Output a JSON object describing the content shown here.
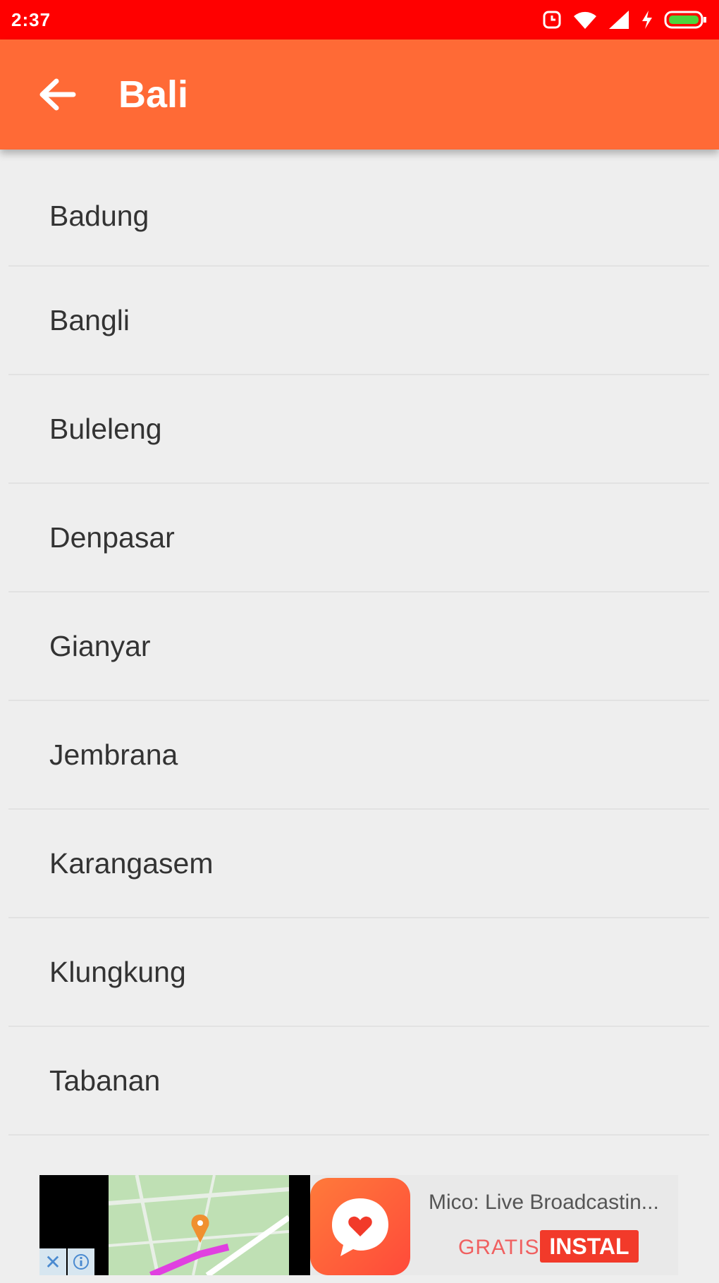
{
  "status_bar": {
    "time": "2:37",
    "icons": [
      "alarm-icon",
      "wifi-icon",
      "signal-icon",
      "charging-icon",
      "battery-icon"
    ],
    "color": "#ff0000"
  },
  "app_bar": {
    "title": "Bali",
    "back_icon": "arrow-left-icon",
    "color": "#ff6a36"
  },
  "list": {
    "items": [
      {
        "label": "Badung"
      },
      {
        "label": "Bangli"
      },
      {
        "label": "Buleleng"
      },
      {
        "label": "Denpasar"
      },
      {
        "label": "Gianyar"
      },
      {
        "label": "Jembrana"
      },
      {
        "label": "Karangasem"
      },
      {
        "label": "Klungkung"
      },
      {
        "label": "Tabanan"
      }
    ]
  },
  "ad": {
    "app_name": "Mico: Live Broadcastin...",
    "gratis_label": "GRATIS",
    "install_label": "INSTAL",
    "close_glyph": "✕",
    "accent_color": "#f23a2a"
  }
}
